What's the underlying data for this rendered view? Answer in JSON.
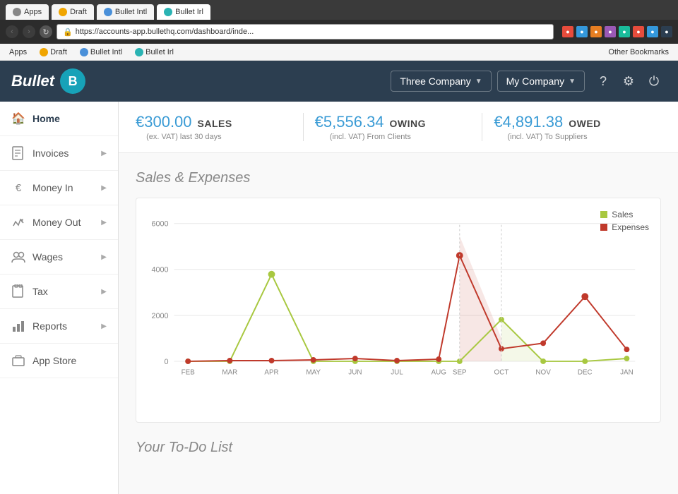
{
  "browser": {
    "back_disabled": true,
    "forward_disabled": true,
    "url": "https://accounts-app.bullethq.com/dashboard/inde...",
    "tabs": [
      {
        "id": "apps",
        "label": "Apps",
        "active": false,
        "icon_color": "#888"
      },
      {
        "id": "draft",
        "label": "Draft",
        "active": false,
        "icon_color": "#f0a500"
      },
      {
        "id": "bullet-intl",
        "label": "Bullet Intl",
        "active": false,
        "icon_color": "#4a90d9"
      },
      {
        "id": "bullet-irl",
        "label": "Bullet Irl",
        "active": true,
        "icon_color": "#2ab3b3"
      }
    ],
    "bookmarks": [
      {
        "id": "apps",
        "label": "Apps",
        "icon_color": "#888"
      },
      {
        "id": "draft",
        "label": "Draft",
        "icon_color": "#f0a500"
      },
      {
        "id": "bullet-intl",
        "label": "Bullet Intl",
        "icon_color": "#4a90d9"
      },
      {
        "id": "bullet-irl",
        "label": "Bullet Irl",
        "icon_color": "#2ab3b3"
      }
    ],
    "other_bookmarks": "Other Bookmarks"
  },
  "app": {
    "logo_letter": "B",
    "logo_text": "Bullet",
    "company_name": "Three Company",
    "company_dropdown_label": "Three Company",
    "my_company_label": "My Company",
    "help_icon": "?",
    "settings_icon": "⚙",
    "power_icon": "⏻"
  },
  "stats": [
    {
      "id": "sales",
      "value": "€300.00",
      "label": "SALES",
      "sub": "(ex. VAT) last 30 days"
    },
    {
      "id": "owing",
      "value": "€5,556.34",
      "label": "OWING",
      "sub": "(incl. VAT) From Clients"
    },
    {
      "id": "owed",
      "value": "€4,891.38",
      "label": "OWED",
      "sub": "(incl. VAT) To Suppliers"
    }
  ],
  "sidebar": {
    "items": [
      {
        "id": "home",
        "label": "Home",
        "icon": "🏠",
        "active": true,
        "has_chevron": false
      },
      {
        "id": "invoices",
        "label": "Invoices",
        "icon": "📄",
        "active": false,
        "has_chevron": true
      },
      {
        "id": "money-in",
        "label": "Money In",
        "icon": "€",
        "active": false,
        "has_chevron": true
      },
      {
        "id": "money-out",
        "label": "Money Out",
        "icon": "✏",
        "active": false,
        "has_chevron": true
      },
      {
        "id": "wages",
        "label": "Wages",
        "icon": "👥",
        "active": false,
        "has_chevron": true
      },
      {
        "id": "tax",
        "label": "Tax",
        "icon": "📅",
        "active": false,
        "has_chevron": true
      },
      {
        "id": "reports",
        "label": "Reports",
        "icon": "📊",
        "active": false,
        "has_chevron": true
      },
      {
        "id": "app-store",
        "label": "App Store",
        "icon": "💻",
        "active": false,
        "has_chevron": false
      }
    ]
  },
  "chart": {
    "title": "Sales & Expenses",
    "legend": {
      "sales_label": "Sales",
      "expenses_label": "Expenses",
      "sales_color": "#a8c840",
      "expenses_color": "#c0392b"
    },
    "y_labels": [
      "6000",
      "4000",
      "2000",
      "0"
    ],
    "x_labels": [
      "FEB",
      "MAR",
      "APR",
      "MAY",
      "JUN",
      "JUL",
      "AUG",
      "SEP",
      "OCT",
      "NOV",
      "DEC",
      "JAN"
    ],
    "sales_data": [
      0,
      0,
      3800,
      0,
      0,
      0,
      0,
      0,
      1800,
      0,
      0,
      120
    ],
    "expenses_data": [
      0,
      30,
      30,
      60,
      130,
      30,
      80,
      4600,
      550,
      800,
      2800,
      530
    ]
  },
  "todo": {
    "title": "Your To-Do List"
  }
}
